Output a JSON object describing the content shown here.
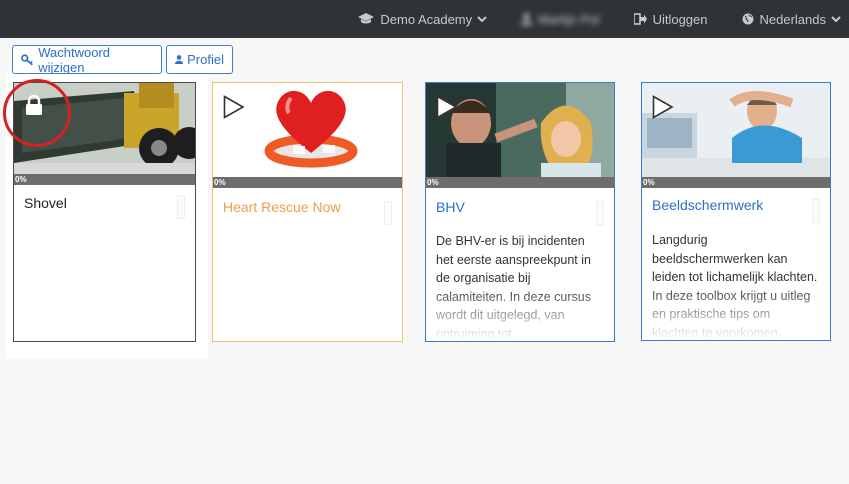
{
  "nav": {
    "academy": "Demo Academy",
    "user": "Martijn Pol",
    "logout": "Uitloggen",
    "language": "Nederlands"
  },
  "toolbar": {
    "change_password": "Wachtwoord wijzigen",
    "profile": "Profiel"
  },
  "courses": [
    {
      "title": "Shovel",
      "progress": "0%",
      "locked": true,
      "description": "",
      "title_color": "#222222",
      "border_color": "#4a4a4a"
    },
    {
      "title": "Heart Rescue Now",
      "progress": "0%",
      "locked": false,
      "description": "",
      "title_color": "#e8a04a",
      "border_color": "#f2c46a"
    },
    {
      "title": "BHV",
      "progress": "0%",
      "locked": false,
      "description": "De BHV-er is bij incidenten het eerste aanspreekpunt in de organisatie bij calamiteiten. In deze cursus wordt dit uitgelegd, van ontruiming tot",
      "title_color": "#2a6fc9",
      "border_color": "#3a7dd0"
    },
    {
      "title": "Beeldschermwerk",
      "progress": "0%",
      "locked": false,
      "description": "Langdurig beeldschermwerken kan leiden tot lichamelijk klachten. In deze toolbox krijgt u uitleg en praktische tips om klachten te voorkomen.",
      "title_color": "#2a6fc9",
      "border_color": "#3a7dd0"
    }
  ],
  "colors": {
    "navbar": "#2f3236",
    "accent": "#2a6fc9",
    "highlight_ring": "#d42222"
  }
}
